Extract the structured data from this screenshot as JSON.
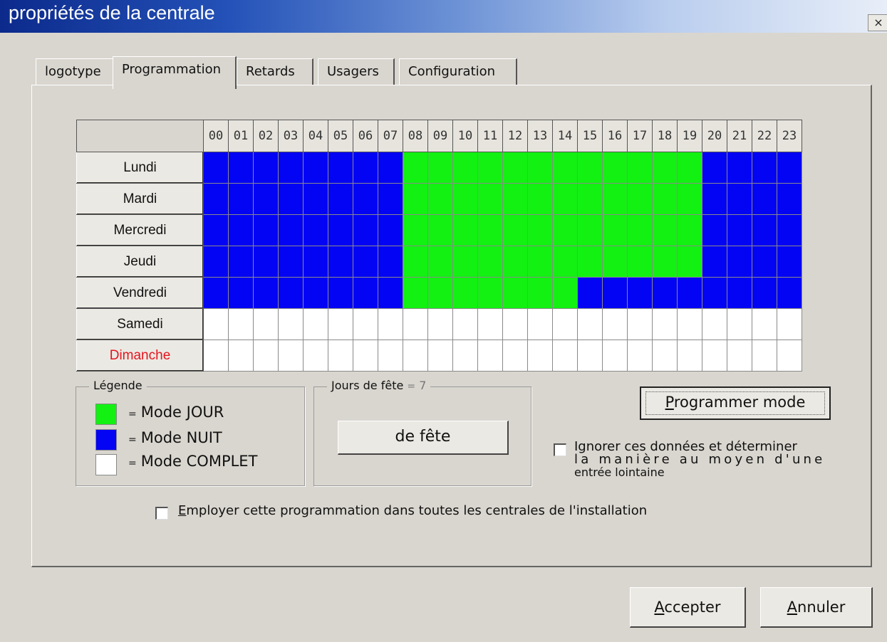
{
  "window": {
    "title": "propriétés de la centrale",
    "close_glyph": "×"
  },
  "tabs": [
    {
      "label": "logotype",
      "active": false
    },
    {
      "label": "Programmation",
      "active": true
    },
    {
      "label": "Retards",
      "active": false
    },
    {
      "label": "Usagers",
      "active": false
    },
    {
      "label": "Configuration",
      "active": false
    }
  ],
  "schedule": {
    "hours": [
      "00",
      "01",
      "02",
      "03",
      "04",
      "05",
      "06",
      "07",
      "08",
      "09",
      "10",
      "11",
      "12",
      "13",
      "14",
      "15",
      "16",
      "17",
      "18",
      "19",
      "20",
      "21",
      "22",
      "23"
    ],
    "days": [
      {
        "label": "Lundi",
        "color": "#111111",
        "modes": "NNNNNNNNJJJJJJJJJJJJNNNN"
      },
      {
        "label": "Mardi",
        "color": "#111111",
        "modes": "NNNNNNNNJJJJJJJJJJJJNNNN"
      },
      {
        "label": "Mercredi",
        "color": "#111111",
        "modes": "NNNNNNNNJJJJJJJJJJJJNNNN"
      },
      {
        "label": "Jeudi",
        "color": "#111111",
        "modes": "NNNNNNNNJJJJJJJJJJJJNNNN"
      },
      {
        "label": "Vendredi",
        "color": "#111111",
        "modes": "NNNNNNNNJJJJJJJNNNNNNNNN"
      },
      {
        "label": "Samedi",
        "color": "#111111",
        "modes": "CCCCCCCCCCCCCCCCCCCCCCCC"
      },
      {
        "label": "Dimanche",
        "color": "#e6141e",
        "modes": "CCCCCCCCCCCCCCCCCCCCCCCC"
      }
    ],
    "mode_colors": {
      "J": "#12f112",
      "N": "#0404f4",
      "C": "#ffffff"
    }
  },
  "legend": {
    "title": "Légende",
    "items": [
      {
        "label": "Mode JOUR",
        "color": "#12f112"
      },
      {
        "label": "Mode NUIT",
        "color": "#0404f4"
      },
      {
        "label": "Mode COMPLET",
        "color": "#ffffff"
      }
    ],
    "eq": "="
  },
  "holidays": {
    "title": "Jours de fête",
    "eq": "=",
    "count": "7",
    "button_label": "de fête"
  },
  "program_mode": {
    "accel": "P",
    "rest": "rogrammer mode"
  },
  "ignore_remote": {
    "checked": false,
    "line1": "Ignorer ces données et déterminer",
    "line2": "la manière au moyen d'une",
    "line3": "entrée lointaine"
  },
  "apply_all": {
    "checked": false,
    "accel": "E",
    "rest": "mployer cette programmation dans toutes les centrales de l'installation"
  },
  "buttons": {
    "accept": {
      "accel": "A",
      "rest": "ccepter"
    },
    "cancel": {
      "accel": "A",
      "rest": "nnuler"
    }
  }
}
